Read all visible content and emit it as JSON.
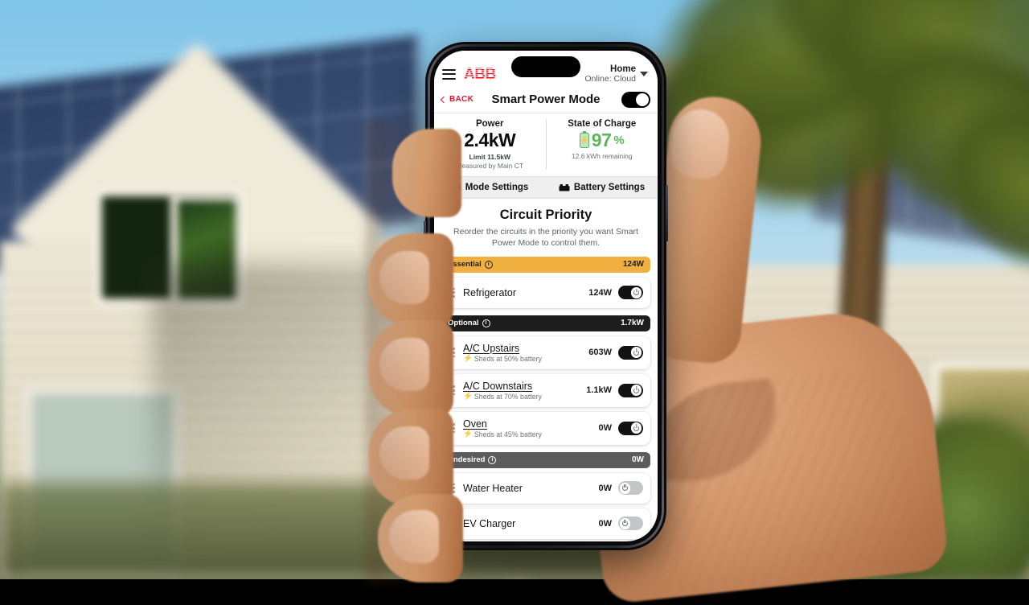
{
  "app": {
    "brand": "ABB",
    "menu_icon": "hamburger-icon",
    "site_name": "Home",
    "connection_status": "Online: Cloud",
    "caret_icon": "chevron-down-icon"
  },
  "nav": {
    "back_label": "BACK",
    "title": "Smart Power Mode",
    "master_toggle_state": "on"
  },
  "stats": {
    "power": {
      "label": "Power",
      "value": "2.4kW",
      "limit": "Limit 11.5kW",
      "source": "Measured by Main CT"
    },
    "soc": {
      "label": "State of Charge",
      "value": "97",
      "unit": "%",
      "remaining": "12.6 kWh remaining",
      "battery_icon": "battery-bolt-icon",
      "color": "#5cb85c"
    }
  },
  "settings_tabs": [
    {
      "label": "Mode Settings",
      "icon": "gear-icon"
    },
    {
      "label": "Battery Settings",
      "icon": "battery-settings-icon"
    }
  ],
  "circuit_priority": {
    "title": "Circuit Priority",
    "description": "Reorder the circuits in the priority you want Smart Power Mode to control them.",
    "groups": [
      {
        "name": "Essential",
        "total": "124W",
        "color": "#f0b040",
        "info_icon": "info-icon",
        "circuits": [
          {
            "name": "Refrigerator",
            "underlined": false,
            "sheds": "",
            "watt": "124W",
            "toggle": "on",
            "drag_icon": "drag-handle-icon"
          }
        ]
      },
      {
        "name": "Optional",
        "total": "1.7kW",
        "color": "#1d1d1d",
        "info_icon": "info-icon",
        "circuits": [
          {
            "name": "A/C Upstairs",
            "underlined": true,
            "sheds": "Sheds at 50% battery",
            "watt": "603W",
            "toggle": "on",
            "drag_icon": "drag-handle-icon"
          },
          {
            "name": "A/C Downstairs",
            "underlined": true,
            "sheds": "Sheds at 70% battery",
            "watt": "1.1kW",
            "toggle": "on",
            "drag_icon": "drag-handle-icon"
          },
          {
            "name": "Oven",
            "underlined": true,
            "sheds": "Sheds at 45% battery",
            "watt": "0W",
            "toggle": "on",
            "drag_icon": "drag-handle-icon"
          }
        ]
      },
      {
        "name": "Undesired",
        "total": "0W",
        "color": "#5c5c5c",
        "info_icon": "info-icon",
        "circuits": [
          {
            "name": "Water Heater",
            "underlined": false,
            "sheds": "",
            "watt": "0W",
            "toggle": "off",
            "drag_icon": "drag-handle-icon"
          },
          {
            "name": "EV Charger",
            "underlined": false,
            "sheds": "",
            "watt": "0W",
            "toggle": "off",
            "drag_icon": "drag-handle-icon"
          }
        ]
      }
    ]
  }
}
